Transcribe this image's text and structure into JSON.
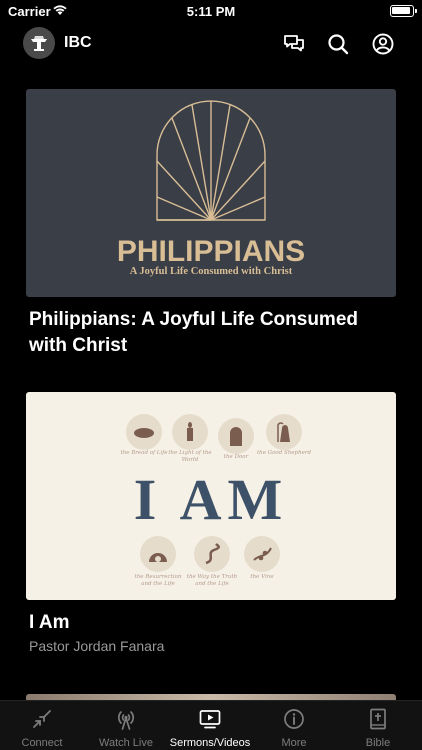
{
  "status": {
    "carrier": "Carrier",
    "time": "5:11 PM"
  },
  "header": {
    "title": "IBC",
    "icons": [
      "chat-icon",
      "search-icon",
      "profile-icon"
    ]
  },
  "cards": [
    {
      "title": "Philippians: A Joyful Life Consumed with Christ",
      "artwork": {
        "heading": "PHILIPPIANS",
        "subheading": "A Joyful Life Consumed with Christ"
      }
    },
    {
      "title": "I Am",
      "speaker": "Pastor Jordan Fanara",
      "artwork": {
        "heading": "I AM",
        "captions": [
          "the Bread of Life",
          "the Light of the World",
          "the Door",
          "the Good Shepherd",
          "the Resurrection and the Life",
          "the Way the Truth and the Life",
          "the Vine"
        ]
      }
    }
  ],
  "tabs": [
    {
      "label": "Connect",
      "icon": "connect-icon",
      "active": false
    },
    {
      "label": "Watch Live",
      "icon": "broadcast-icon",
      "active": false
    },
    {
      "label": "Sermons/Videos",
      "icon": "play-video-icon",
      "active": true
    },
    {
      "label": "More",
      "icon": "info-icon",
      "active": false
    },
    {
      "label": "Bible",
      "icon": "bible-icon",
      "active": false
    }
  ],
  "colors": {
    "accent": "#ffffff",
    "inactive_tab": "#7d7d7d",
    "philippians_gold": "#d8bd95",
    "iam_blue": "#3d5268"
  }
}
